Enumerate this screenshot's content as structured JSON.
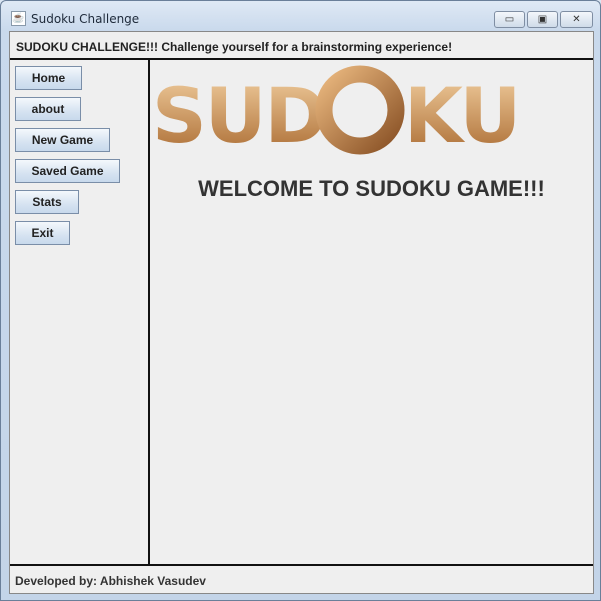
{
  "window": {
    "title": "Sudoku Challenge",
    "minimize": "▭",
    "maximize": "▣",
    "close": "✕"
  },
  "header": {
    "text": "SUDOKU CHALLENGE!!! Challenge yourself for a brainstorming experience!"
  },
  "sidebar": {
    "buttons": [
      {
        "label": "Home"
      },
      {
        "label": "about"
      },
      {
        "label": "New Game"
      },
      {
        "label": "Saved Game"
      },
      {
        "label": "Stats"
      },
      {
        "label": "Exit"
      }
    ]
  },
  "main": {
    "logo_text": "SUDOKU",
    "welcome": "WELCOME TO SUDOKU GAME!!!"
  },
  "footer": {
    "text": "Developed by: Abhishek Vasudev"
  },
  "colors": {
    "logo_light": "#f0c896",
    "logo_dark": "#a8682e"
  }
}
